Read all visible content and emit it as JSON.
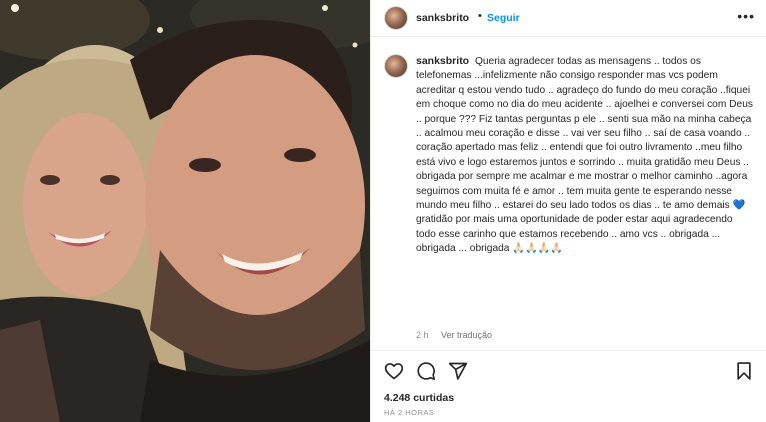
{
  "post": {
    "username": "sanksbrito",
    "follow_label": "Seguir",
    "dot": "•",
    "more_label": "•••"
  },
  "caption": {
    "username": "sanksbrito",
    "text": "Queria agradecer todas as mensagens .. todos os telefonemas ...infelizmente não consigo responder mas vcs podem acreditar q estou vendo tudo .. agradeço do fundo do meu coração ..fiquei em choque como no dia do meu acidente .. ajoelhei e conversei com Deus .. porque ??? Fiz tantas perguntas p ele .. senti sua mão na minha cabeça .. acalmou meu coração e disse .. vai ver seu filho .. saí de casa voando .. coração apertado mas feliz .. entendi que foi outro livramento ..meu filho está vivo e logo estaremos juntos e sorrindo .. muita gratidão meu Deus .. obrigada por sempre me acalmar e me mostrar o melhor caminho ..agora seguimos com muita fé e amor .. tem muita gente te esperando nesse mundo meu filho .. estarei do seu lado todos os dias .. te amo demais 💙 gratidão por mais uma oportunidade de poder estar aqui agradecendo todo esse carinho que estamos recebendo .. amo vcs .. obrigada ... obrigada ... obrigada 🙏🏻🙏🏻🙏🏻🙏🏻",
    "age": "2 h",
    "translate_label": "Ver tradução"
  },
  "actions": {
    "like": "heart-icon",
    "comment": "comment-icon",
    "share": "share-icon",
    "save": "bookmark-icon"
  },
  "stats": {
    "likes": "4.248 curtidas",
    "time_ago": "HÁ 2 HORAS"
  },
  "colors": {
    "follow": "#0095f6",
    "text": "#262626",
    "muted": "#8e8e8e",
    "divider": "#efefef"
  }
}
